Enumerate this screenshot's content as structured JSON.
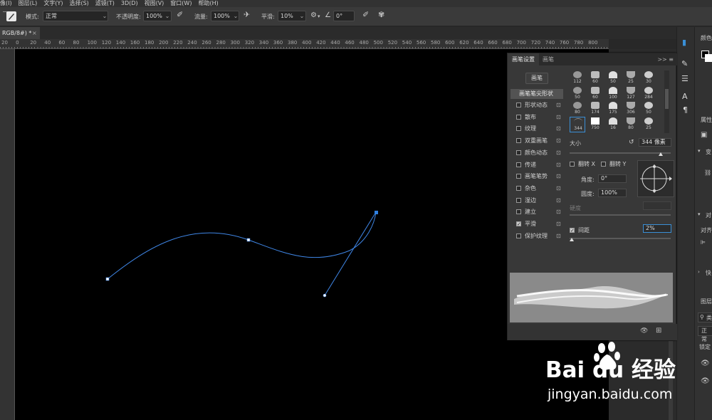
{
  "menubar": {
    "items": [
      "像(I)",
      "图层(L)",
      "文字(Y)",
      "选择(S)",
      "滤镜(T)",
      "3D(D)",
      "视图(V)",
      "窗口(W)",
      "帮助(H)"
    ]
  },
  "options": {
    "mode_label": "模式:",
    "mode_value": "正常",
    "opacity_label": "不透明度:",
    "opacity_value": "100%",
    "flow_label": "流量:",
    "flow_value": "100%",
    "smoothing_label": "平滑:",
    "smoothing_value": "10%",
    "angle_value": "0°"
  },
  "document": {
    "tab_title": "RGB/8#) *",
    "close_glyph": "×"
  },
  "ruler": {
    "labels": [
      "20",
      "0",
      "20",
      "40",
      "60",
      "80",
      "100",
      "120",
      "140",
      "160",
      "180",
      "200",
      "220",
      "240",
      "260",
      "280",
      "300",
      "320",
      "340",
      "360",
      "380",
      "400",
      "420",
      "440",
      "460",
      "480",
      "500",
      "520",
      "540",
      "560",
      "580",
      "600",
      "620",
      "640",
      "660",
      "680",
      "700",
      "720",
      "740",
      "760",
      "780",
      "800"
    ]
  },
  "brush_panel": {
    "tab_settings": "画笔设置",
    "tab_brushes": "画笔",
    "menu_glyph": ">> ≡",
    "brush_button": "画笔",
    "tip_shape": "画笔笔尖形状",
    "options": [
      {
        "label": "形状动态",
        "checked": false
      },
      {
        "label": "散布",
        "checked": false
      },
      {
        "label": "纹理",
        "checked": false
      },
      {
        "label": "双重画笔",
        "checked": false
      },
      {
        "label": "颜色动态",
        "checked": false
      },
      {
        "label": "传递",
        "checked": false
      },
      {
        "label": "画笔笔势",
        "checked": false
      },
      {
        "label": "杂色",
        "checked": false
      },
      {
        "label": "湿边",
        "checked": false
      },
      {
        "label": "建立",
        "checked": false
      },
      {
        "label": "平滑",
        "checked": true
      },
      {
        "label": "保护纹理",
        "checked": false
      }
    ],
    "lock_glyph": "🔒",
    "brush_sizes": [
      "112",
      "60",
      "50",
      "25",
      "30",
      "50",
      "60",
      "100",
      "127",
      "284",
      "80",
      "174",
      "175",
      "306",
      "50",
      "344",
      "750",
      "16",
      "80",
      "25"
    ],
    "selected_brush_index": 15,
    "size_label": "大小",
    "size_value": "344 像素",
    "size_level": 0.9,
    "flip_x": "翻转 X",
    "flip_y": "翻转 Y",
    "angle_label": "角度:",
    "angle_value": "0°",
    "roundness_label": "圆度:",
    "roundness_value": "100%",
    "hardness_label": "硬度",
    "spacing_label": "间距",
    "spacing_value": "2%",
    "spacing_checked": true,
    "spacing_level": 0.02
  },
  "right_panels": {
    "color_title": "颜色",
    "properties_title": "属性",
    "transform_abbr": "变",
    "align_abbr": "对",
    "align_label": "对齐",
    "collapse_abbr": "快",
    "layers_title": "图层",
    "search_abbr": "类",
    "blend_abbr": "正常",
    "lock_abbr": "锁定"
  },
  "watermark": {
    "logo": "Bai  du 经验",
    "url": "jingyan.baidu.com"
  },
  "colors": {
    "path_stroke": "#3f86e6",
    "anchor_fill": "#ffffff",
    "selected_anchor": "#2f7fe0",
    "canvas_bg": "#000000"
  }
}
